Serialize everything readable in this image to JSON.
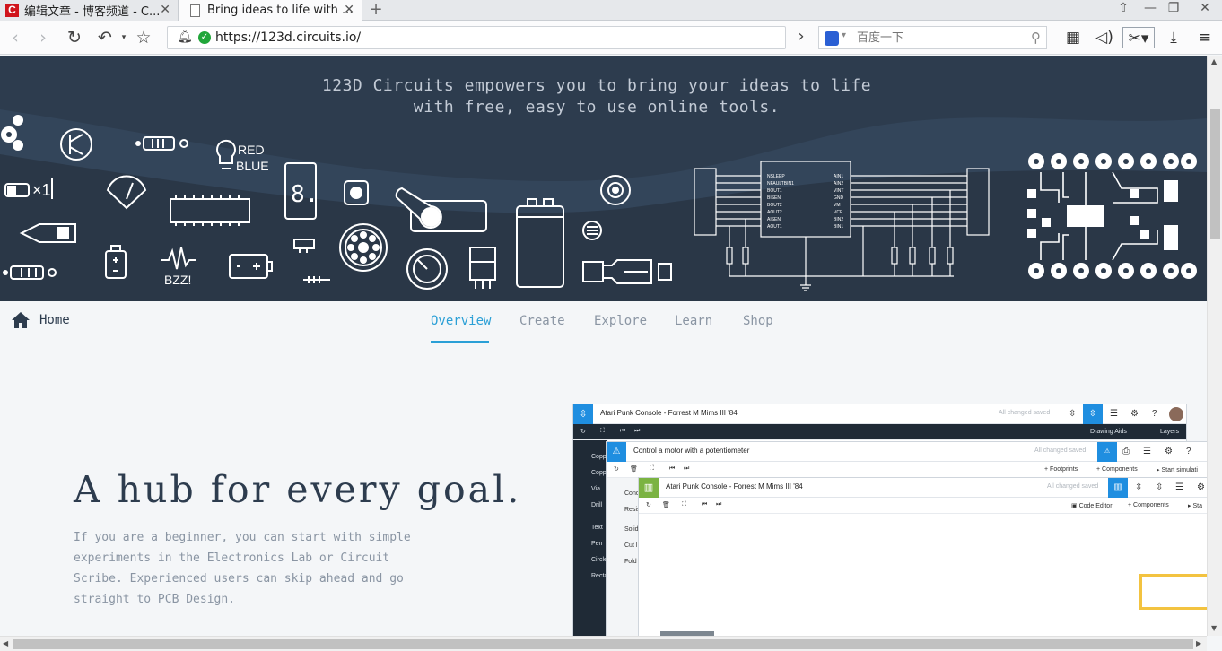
{
  "browser": {
    "tabs": [
      {
        "title": "编辑文章 - 博客频道 - C...",
        "active": false
      },
      {
        "title": "Bring ideas to life with ...",
        "active": true
      }
    ],
    "url": "https://123d.circuits.io/",
    "search_placeholder": "百度一下"
  },
  "hero": {
    "tagline_line1": "123D Circuits empowers you to bring your ideas to life",
    "tagline_line2": "with free, easy to use online tools.",
    "art_labels": {
      "bulb_text_1": "RED",
      "bulb_text_2": "BLUE",
      "multiplier": "×1",
      "buzz": "BZZ!",
      "display_digit": "8.",
      "chip_pins_left": [
        "NSLEEP",
        "NFAULTBIN1",
        "BOUT1",
        "BISEN",
        "BOUT2",
        "AOUT2",
        "AISEN",
        "AOUT1"
      ],
      "chip_pins_right": [
        "AIN1",
        "AIN2",
        "VINT",
        "GND",
        "VM",
        "VCP",
        "BIN2",
        "BIN1"
      ]
    }
  },
  "subnav": {
    "home": "Home",
    "tabs": [
      {
        "label": "Overview",
        "active": true
      },
      {
        "label": "Create",
        "active": false
      },
      {
        "label": "Explore",
        "active": false
      },
      {
        "label": "Learn",
        "active": false
      },
      {
        "label": "Shop",
        "active": false
      }
    ]
  },
  "main": {
    "title": "A hub for every goal.",
    "body": "If you are a beginner, you can start with simple experiments in the Electronics Lab or Circuit Scribe. Experienced users can skip ahead and go straight to PCB Design."
  },
  "app_shot": {
    "win1": {
      "title": "Atari Punk Console - Forrest M Mims III '84",
      "saved": "All changed saved",
      "menu": [
        "Drawing Aids",
        "Layers"
      ],
      "side": [
        "Copp",
        "Copp",
        "Via",
        "Drill",
        "Text",
        "Pen",
        "Circle",
        "Recta"
      ]
    },
    "win2": {
      "title": "Control a motor with a potentiometer",
      "saved": "All changed saved",
      "menu": [
        "Footprints",
        "Components",
        "Start simulati"
      ],
      "side": [
        "Cond",
        "Resis",
        "Solid",
        "Cut l",
        "Fold"
      ]
    },
    "win3": {
      "title": "Atari Punk Console - Forrest M Mims III '84",
      "saved": "All changed saved",
      "menu": [
        "Code Editor",
        "Components",
        "Sta"
      ]
    }
  },
  "colors": {
    "hero_bg": "#2d3c4e",
    "accent": "#2a9fd6",
    "app_blue": "#1f8ee0",
    "app_green": "#7bb342"
  }
}
